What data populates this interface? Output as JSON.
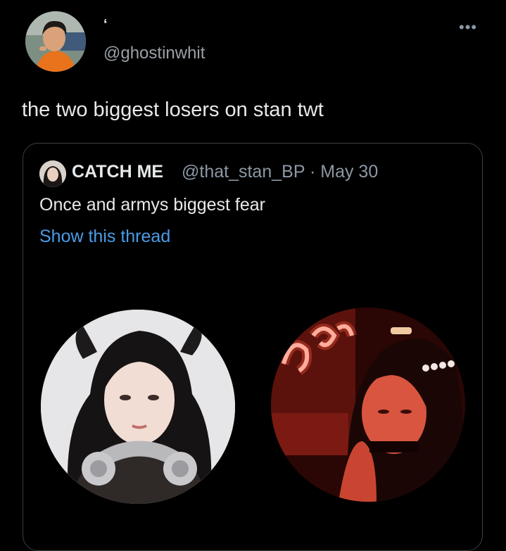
{
  "tweet": {
    "display_name": "‘",
    "handle": "@ghostinwhit",
    "more_label": "•••",
    "text": "the two biggest losers on stan twt"
  },
  "quoted_tweet": {
    "name": "CATCH ME",
    "handle_date": "@that_stan_BP · May 30",
    "text": "Once and armys biggest fear",
    "link": "Show this thread"
  },
  "icons": [
    "more-options-icon"
  ],
  "colors": {
    "background": "#000000",
    "text": "#e7e9ea",
    "muted": "#8b98a5",
    "link": "#4a9be8",
    "border": "#3a3f44"
  }
}
